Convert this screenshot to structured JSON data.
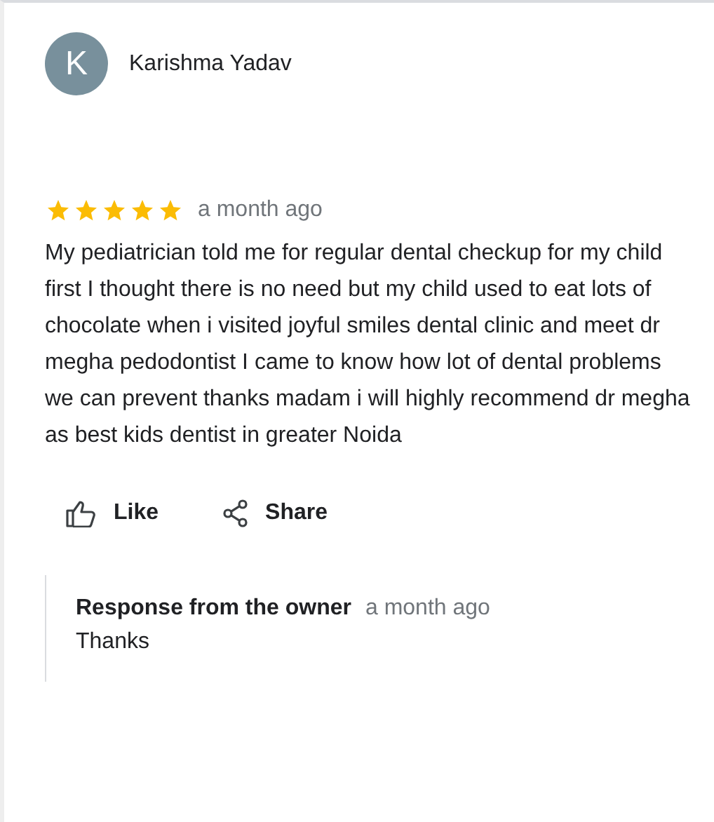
{
  "review": {
    "avatar_letter": "K",
    "author": "Karishma Yadav",
    "stars": 5,
    "time": "a month ago",
    "text": "My pediatrician told me for regular dental checkup for my child first I thought there is no need but my child used to eat lots of chocolate when i visited joyful smiles dental clinic and meet dr megha pedodontist I came to know how lot of dental problems we can prevent thanks madam i will highly recommend dr megha as best kids dentist in greater Noida"
  },
  "actions": [
    {
      "kind": "like",
      "label": "Like"
    },
    {
      "kind": "share",
      "label": "Share"
    }
  ],
  "owner_response": {
    "title": "Response from the owner",
    "time": "a month ago",
    "text": "Thanks"
  }
}
